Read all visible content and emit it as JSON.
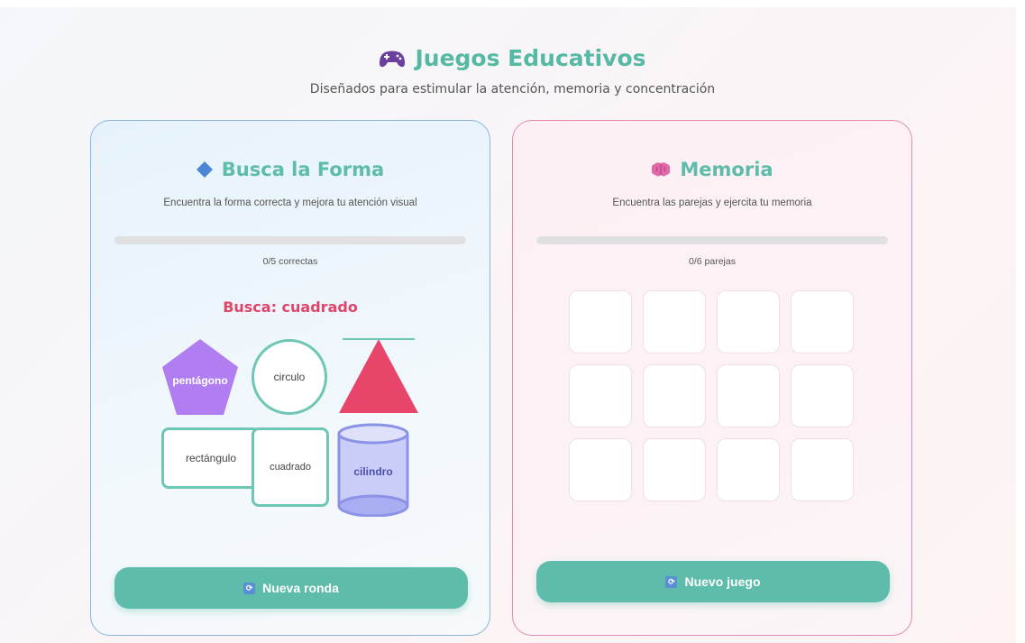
{
  "header": {
    "title": "Juegos Educativos",
    "subtitle": "Diseñados para estimular la atención, memoria y concentración",
    "icon": "gamepad-icon"
  },
  "shape_game": {
    "title": "Busca la Forma",
    "icon": "diamond-icon",
    "description": "Encuentra la forma correcta y mejora tu atención visual",
    "progress_fraction": 0,
    "progress_text": "0/5 correctas",
    "target_text": "Busca: cuadrado",
    "shapes": {
      "pentagon": "pentágono",
      "circle": "circulo",
      "rectangle": "rectángulo",
      "square": "cuadrado",
      "cylinder": "cilindro"
    },
    "button_label": "Nueva ronda"
  },
  "memory_game": {
    "title": "Memoria",
    "icon": "brain-icon",
    "description": "Encuentra las parejas y ejercita tu memoria",
    "progress_fraction": 0,
    "progress_text": "0/6 parejas",
    "card_count": 12,
    "button_label": "Nuevo juego"
  },
  "colors": {
    "accent": "#5dbcaa",
    "target": "#e0456a",
    "pentagon": "#b07ef0",
    "triangle": "#e8456a",
    "cylinder": "#a9aef2"
  }
}
